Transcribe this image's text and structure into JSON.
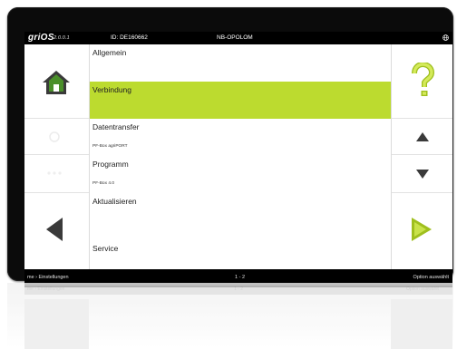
{
  "header": {
    "brand": "griOS",
    "version": "2.0.0.1",
    "device_id": "ID: DE160662",
    "device_name": "NB-OPOLOM"
  },
  "menu": {
    "items": [
      {
        "label": "Allgemein",
        "sub": ""
      },
      {
        "label": "Verbindung",
        "sub": ""
      },
      {
        "label": "Datentransfer",
        "sub": "PF-Box agriPORT"
      },
      {
        "label": "Programm",
        "sub": "PF-Box 4.0"
      },
      {
        "label": "Aktualisieren",
        "sub": ""
      },
      {
        "label": "Service",
        "sub": ""
      }
    ],
    "selected_index": 1
  },
  "footer": {
    "breadcrumb": "me › Einstellungen",
    "page": "1 - 2",
    "hint": "Option auswählt"
  },
  "colors": {
    "accent": "#bcdb2f",
    "icon_green": "#4a8f2a",
    "icon_dark": "#3a3a3a",
    "icon_yellow": "#c9e24a"
  },
  "icons": {
    "home": "home-icon",
    "help": "help-icon",
    "up": "arrow-up-icon",
    "down": "arrow-down-icon",
    "back": "triangle-left-icon",
    "forward": "triangle-right-icon",
    "globe": "globe-icon"
  }
}
